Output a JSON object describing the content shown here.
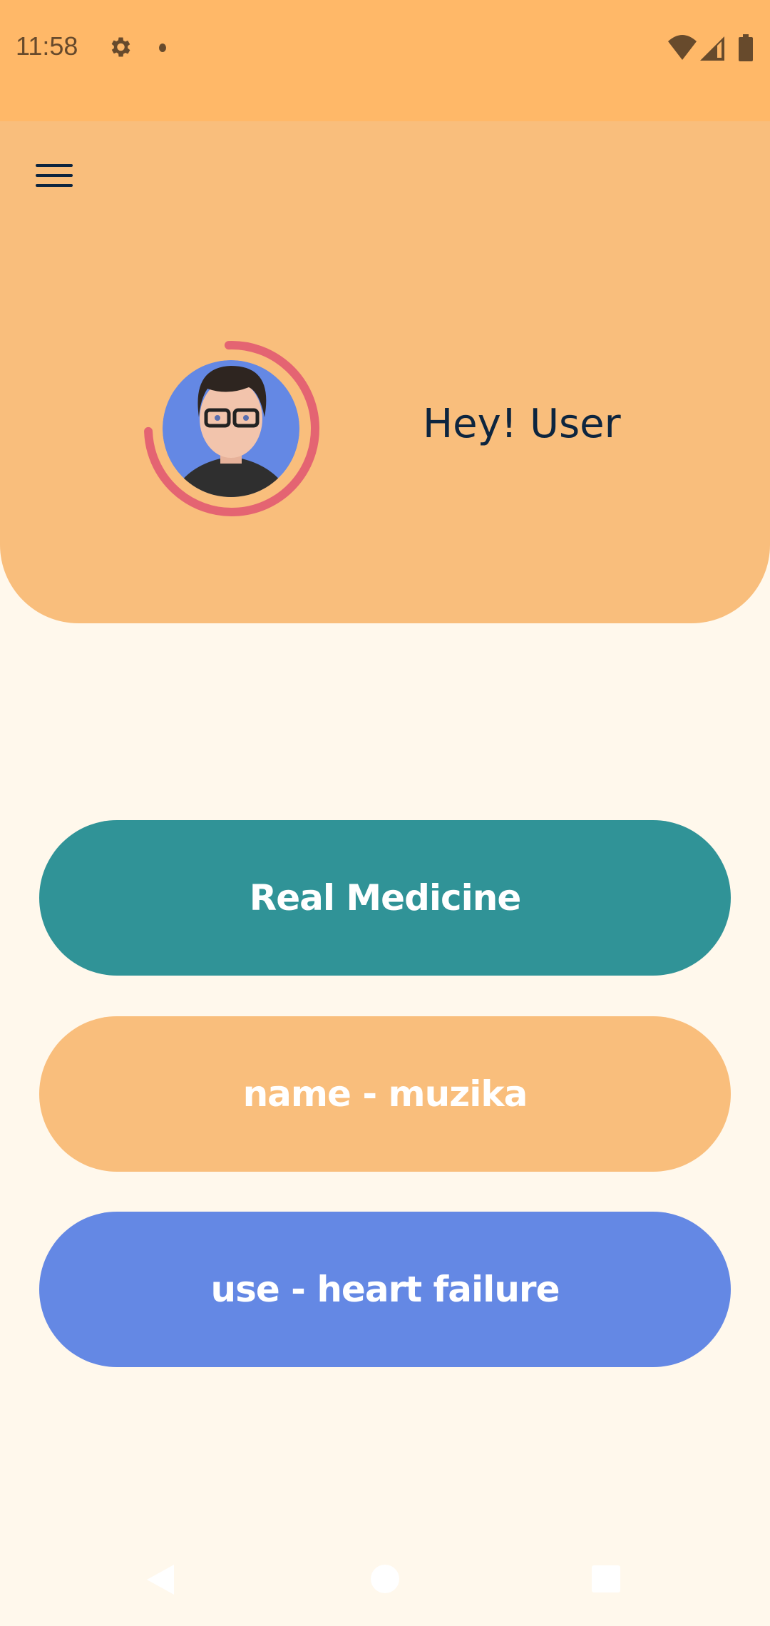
{
  "status_bar": {
    "time": "11:58",
    "icons": [
      "gear-icon",
      "dot-icon",
      "wifi-icon",
      "signal-icon",
      "battery-icon"
    ]
  },
  "header": {
    "menu_icon": "hamburger-menu-icon",
    "greeting": "Hey! User",
    "progress_ring_fraction": 0.75
  },
  "buttons": [
    {
      "label": "Real Medicine",
      "color": "#309397"
    },
    {
      "label": "name - muzika",
      "color": "#F9BE7C"
    },
    {
      "label": "use - heart failure",
      "color": "#6488E4"
    }
  ],
  "colors": {
    "status_bar": "#FFB868",
    "header": "#F9BE7C",
    "background": "#FFF8EC",
    "ring": "#E46472",
    "text": "#0D253F"
  },
  "nav": [
    "back-icon",
    "home-icon",
    "recents-icon"
  ]
}
